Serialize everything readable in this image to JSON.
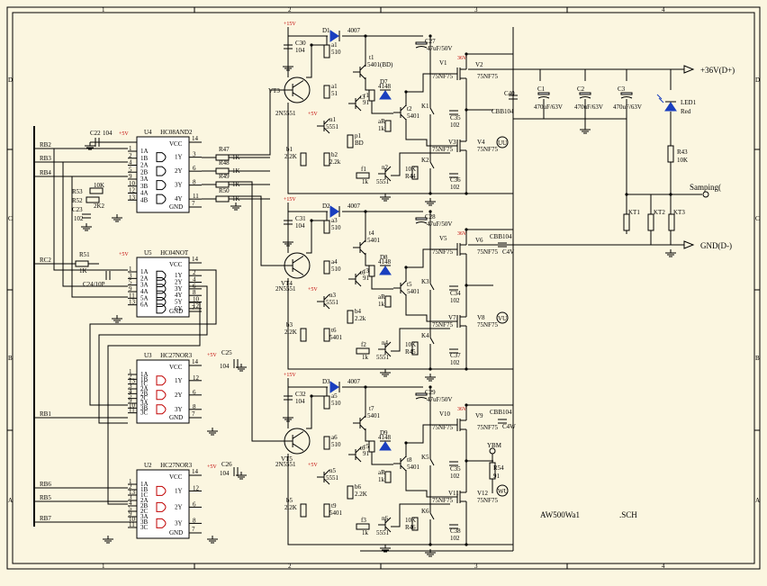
{
  "frame": {
    "cols": [
      "1",
      "2",
      "3",
      "4"
    ],
    "rows": [
      "D",
      "C",
      "B",
      "A"
    ]
  },
  "title": "AW500Wa1",
  "filename": ".SCH",
  "ports": {
    "vplus": "+36V(D+)",
    "gnd": "GND(D-)",
    "sampling": "Samping(",
    "uu": "UU",
    "vu": "VU",
    "wu": "WU",
    "ybm": "YBM"
  },
  "nets": [
    "RB2",
    "RB3",
    "RB4",
    "RC2",
    "RB1",
    "RB6",
    "RB5",
    "RB7"
  ],
  "supply": {
    "v15": "+15V",
    "v5": "+5V",
    "v36": "36V"
  },
  "ics": {
    "u4": {
      "name": "U4",
      "part": "HC08AND2",
      "pins": [
        "1A",
        "1B",
        "2A",
        "2B",
        "3A",
        "3B",
        "4A",
        "4B"
      ],
      "out": [
        "1Y",
        "2Y",
        "3Y",
        "4Y"
      ],
      "vcc": "VCC",
      "gnd": "GND",
      "pnum_l": [
        "1",
        "2",
        "4",
        "5",
        "9",
        "10",
        "12",
        "13"
      ],
      "pnum_r": [
        "3",
        "6",
        "8",
        "11"
      ],
      "p14": "14",
      "p7": "7"
    },
    "u5": {
      "name": "U5",
      "part": "HC04NOT",
      "pins": [
        "1A",
        "2A",
        "3A",
        "4A",
        "5A",
        "6A"
      ],
      "out": [
        "1Y",
        "2Y",
        "3Y",
        "4Y",
        "5Y",
        "6Y"
      ],
      "vcc": "VCC",
      "gnd": "GND",
      "pnum_l": [
        "1",
        "3",
        "5",
        "9",
        "11",
        "13"
      ],
      "pnum_r": [
        "2",
        "4",
        "6",
        "8",
        "10",
        "12"
      ],
      "p14": "14",
      "p7": "7"
    },
    "u3": {
      "name": "U3",
      "part": "HC27NOR3",
      "pins": [
        "1A",
        "1B",
        "1C",
        "2A",
        "2B",
        "2C",
        "3A",
        "3B",
        "3C"
      ],
      "out": [
        "1Y",
        "2Y",
        "3Y"
      ],
      "vcc": "VCC",
      "gnd": "GND",
      "pnum_l": [
        "1",
        "2",
        "13",
        "3",
        "4",
        "5",
        "9",
        "10",
        "11"
      ],
      "pnum_r": [
        "12",
        "6",
        "8"
      ],
      "p14": "14",
      "p7": "7"
    },
    "u2": {
      "name": "U2",
      "part": "HC27NOR3",
      "pins": [
        "1A",
        "1B",
        "1C",
        "2A",
        "2B",
        "2C",
        "3A",
        "3B",
        "3C"
      ],
      "out": [
        "1Y",
        "2Y",
        "3Y"
      ],
      "vcc": "VCC",
      "gnd": "GND",
      "pnum_l": [
        "1",
        "2",
        "13",
        "3",
        "4",
        "5",
        "9",
        "10",
        "11"
      ],
      "pnum_r": [
        "12",
        "6",
        "8"
      ],
      "p14": "14",
      "p7": "7"
    }
  },
  "left": {
    "c22": {
      "ref": "C22",
      "val": "104"
    },
    "r53": {
      "ref": "R53",
      "val": "10K"
    },
    "r52": {
      "ref": "R52",
      "val": "2K2"
    },
    "c23": {
      "ref": "C23",
      "val": "102"
    },
    "r51": {
      "ref": "R51",
      "val": "1K"
    },
    "c24": {
      "ref": "C24/10P"
    },
    "c25": {
      "ref": "C25",
      "val": "104"
    },
    "c26": {
      "ref": "C26",
      "val": "104"
    },
    "r47": "R47",
    "r48": "R48",
    "r49": "R49",
    "r50": "R50",
    "r1k": "1K"
  },
  "stages": [
    {
      "d": "D1",
      "dv": "4007",
      "c": "C30",
      "cv": "104",
      "vt": "VT3",
      "vtp": "2N5551",
      "a1": "a1",
      "av": "510",
      "t1": "t1",
      "tv": "5401(BD)",
      "r1": "r1",
      "rv": "91",
      "d4": "4148",
      "d4r": "D7",
      "t2": "t2",
      "t2v": "5401",
      "ar": "aR",
      "arv": "1k",
      "n1": "n1",
      "nv": "5551",
      "a1b": "a1",
      "a1v": "51",
      "b1": "b1",
      "b1v": "2.2K",
      "p1": "p1",
      "p1v": "BD",
      "b2": "b2",
      "b2v": "2.2k",
      "f1": "f1",
      "f1v": "1k",
      "n2": "n2",
      "n2v": "5551",
      "r44": "R44",
      "r44v": "10K",
      "k": [
        "K1",
        "K2"
      ],
      "c27": "C27",
      "c27v": "47uF/50V",
      "v1": "V1",
      "v1p": "75NF75",
      "v2": "V2",
      "v2p": "75NF75",
      "v3": "V3",
      "v3p": "75NF75",
      "v4": "V4",
      "v4p": "75NF75",
      "c35": "C35",
      "c35v": "102",
      "c36": "C36",
      "c36v": "102",
      "r5": "5"
    },
    {
      "d": "D2",
      "dv": "4007",
      "c": "C31",
      "cv": "104",
      "vt": "VT4",
      "vtp": "2N5551",
      "a1": "a3",
      "av": "510",
      "t1": "t4",
      "tv": "5401",
      "r1": "r3",
      "rv": "91",
      "d4": "4148",
      "d4r": "D8",
      "t2": "t5",
      "t2v": "5401",
      "ar": "aR",
      "arv": "1k",
      "n1": "n3",
      "nv": "5551",
      "a1b": "a4",
      "a1v": "510",
      "b1": "b3",
      "b1v": "2.2K",
      "p1": "b4",
      "p1v": "2.2k",
      "b2": "t6",
      "b2v": "5401",
      "f1": "f2",
      "f1v": "1k",
      "n2": "n4",
      "n2v": "5551",
      "r44": "R45",
      "r44v": "10K",
      "k": [
        "K3",
        "K4"
      ],
      "c27": "C28",
      "c27v": "47uF/50V",
      "v1": "V5",
      "v1p": "75NF75",
      "v2": "V6",
      "v2p": "75NF75",
      "v3": "V7",
      "v3p": "75NF75",
      "v4": "V8",
      "v4p": "75NF75",
      "c35": "C34",
      "c35v": "102",
      "c36": "C37",
      "c36v": "102",
      "r5": "a4"
    },
    {
      "d": "D3",
      "dv": "4007",
      "c": "C32",
      "cv": "104",
      "vt": "VT5",
      "vtp": "2N5551",
      "a1": "a5",
      "av": "510",
      "t1": "t7",
      "tv": "5401",
      "r1": "r5",
      "rv": "91",
      "d4": "4148",
      "d4r": "D9",
      "t2": "t8",
      "t2v": "5401",
      "ar": "aR",
      "arv": "1k",
      "n1": "n5",
      "nv": "5551",
      "a1b": "a6",
      "a1v": "510",
      "b1": "b5",
      "b1v": "2.2K",
      "p1": "b6",
      "p1v": "2.2K",
      "b2": "t9",
      "b2v": "5401",
      "f1": "f3",
      "f1v": "1k",
      "n2": "n6",
      "n2v": "5551",
      "r44": "R46",
      "r44v": "10K",
      "k": [
        "K5",
        "K6"
      ],
      "c27": "C29",
      "c27v": "47uF/50V",
      "v1": "V10",
      "v1p": "75NF75",
      "v2": "V9",
      "v2p": "75NF75",
      "v3": "V11",
      "v3p": "75NF75",
      "v4": "V12",
      "v4p": "75NF75",
      "c35": "C35",
      "c35v": "102",
      "c36": "C38",
      "c36v": "102",
      "r5": "a6"
    }
  ],
  "right": {
    "c40": {
      "ref": "C40",
      "val": "CBB104"
    },
    "c1": {
      "ref": "C1",
      "val": "470uF/63V"
    },
    "c2": {
      "ref": "C2",
      "val": "470uF/63V"
    },
    "c3": {
      "ref": "C3",
      "val": "470uF/63V"
    },
    "cbb2": {
      "ref": "CBB104",
      "val": "C4V"
    },
    "cbb3": {
      "ref": "CBB104",
      "val": "C4W"
    },
    "led": {
      "ref": "LED1",
      "val": "Red"
    },
    "r43": {
      "ref": "R43",
      "val": "10K"
    },
    "r54": {
      "ref": "R54",
      "val": "91"
    },
    "kt": [
      "KT1",
      "KT2",
      "KT3"
    ]
  }
}
